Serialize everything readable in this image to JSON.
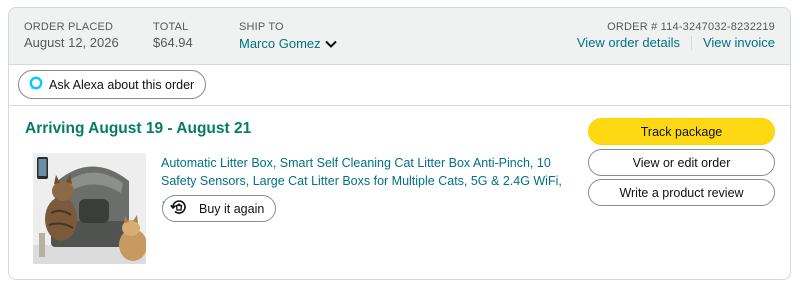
{
  "header": {
    "order_placed_label": "ORDER PLACED",
    "order_placed_value": "August 12, 2026",
    "total_label": "TOTAL",
    "total_value": "$64.94",
    "ship_to_label": "SHIP TO",
    "ship_to_name": "Marco Gomez",
    "order_number": "ORDER # 114-3247032-8232219",
    "view_order_details": "View order details",
    "view_invoice": "View invoice"
  },
  "alexa": {
    "label": "Ask Alexa about this order",
    "icon": "alexa-ring-icon"
  },
  "shipment": {
    "status": "Arriving August 19 - August 21",
    "product_title": "Automatic Litter Box, Smart Self Cleaning Cat Litter Box Anti-Pinch, 10 Safety Sensors, Large Cat Litter Boxs for Multiple Cats, 5G & 2.4G WiFi, …",
    "buy_again_label": "Buy it again",
    "buy_again_icon": "buy-again-icon"
  },
  "actions": {
    "track_package": "Track package",
    "view_or_edit": "View or edit order",
    "write_review": "Write a product review"
  },
  "colors": {
    "link": "#007185",
    "arriving": "#067d62",
    "primary_button": "#ffd814",
    "header_bg": "#f0f2f2",
    "border": "#d5d9d9"
  }
}
